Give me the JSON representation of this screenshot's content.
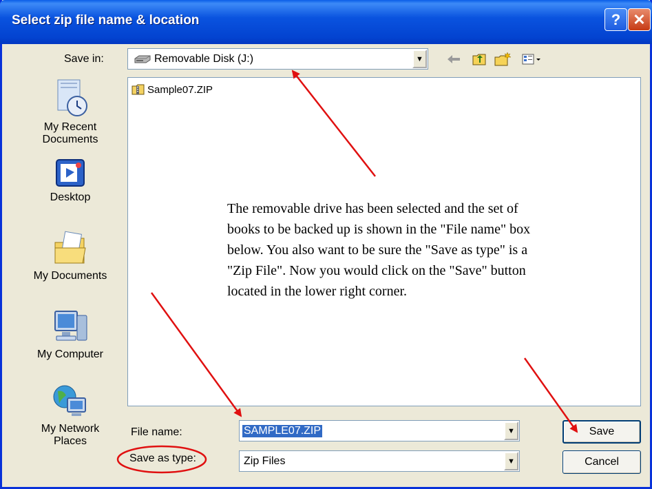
{
  "window": {
    "title": "Select zip file name & location",
    "help_glyph": "?",
    "close_glyph": "✕"
  },
  "save_in": {
    "label": "Save in:",
    "value": "Removable Disk (J:)",
    "drop_glyph": "▼",
    "icon": "removable-disk-icon"
  },
  "toolbar": {
    "back_icon": "back-arrow-icon",
    "up_icon": "up-folder-icon",
    "new_folder_icon": "new-folder-icon",
    "views_icon": "views-menu-icon"
  },
  "places": [
    {
      "label": "My Recent Documents",
      "icon": "recent-documents-icon"
    },
    {
      "label": "Desktop",
      "icon": "desktop-icon"
    },
    {
      "label": "My Documents",
      "icon": "my-documents-icon"
    },
    {
      "label": "My Computer",
      "icon": "my-computer-icon"
    },
    {
      "label": "My Network Places",
      "icon": "my-network-places-icon"
    }
  ],
  "files": [
    {
      "name": "Sample07.ZIP",
      "icon": "zip-folder-icon"
    }
  ],
  "annotation": {
    "text": "The removable drive has been selected and the set of books to be backed up is shown in the \"File name\" box below.  You also want to be sure the \"Save as type\" is a \"Zip File\".  Now you would click on the \"Save\" button located in the lower right corner."
  },
  "file_name": {
    "label": "File name:",
    "value": "SAMPLE07.ZIP",
    "drop_glyph": "▼"
  },
  "save_type": {
    "label": "Save as type:",
    "value": "Zip Files",
    "drop_glyph": "▼"
  },
  "buttons": {
    "save": "Save",
    "cancel": "Cancel"
  },
  "colors": {
    "title_bar": "#0a53df",
    "dialog_bg": "#ece9d8",
    "selection": "#316ac5",
    "annotation_red": "#e01010"
  }
}
